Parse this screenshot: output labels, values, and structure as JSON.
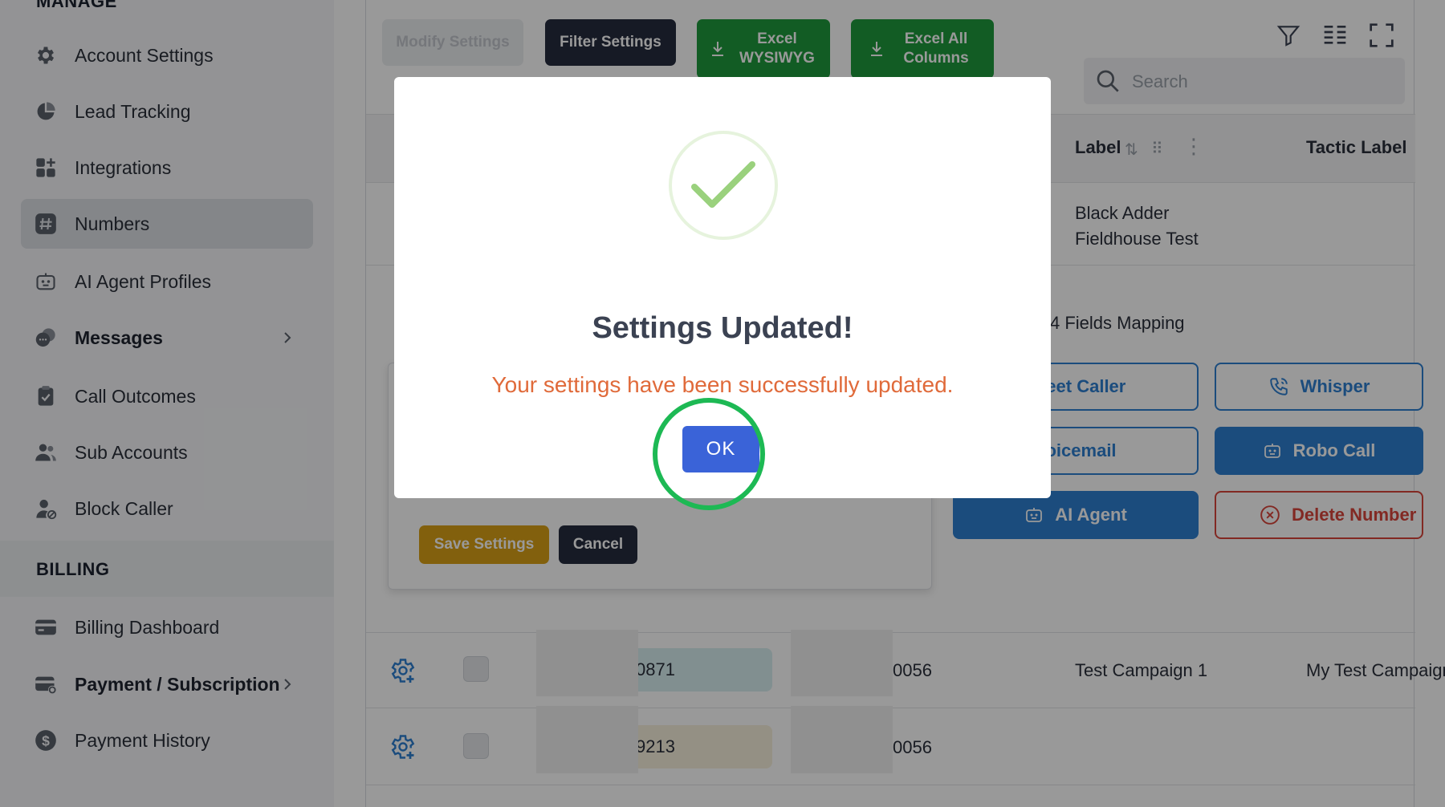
{
  "sidebar": {
    "manage_heading": "MANAGE",
    "billing_heading": "BILLING",
    "manage_items": [
      {
        "label": "Account Settings",
        "icon": "gear-icon"
      },
      {
        "label": "Lead Tracking",
        "icon": "pie-chart-icon"
      },
      {
        "label": "Integrations",
        "icon": "apps-grid-icon"
      },
      {
        "label": "Numbers",
        "icon": "hash-icon",
        "active": true
      },
      {
        "label": "AI Agent Profiles",
        "icon": "robot-icon"
      },
      {
        "label": "Messages",
        "icon": "chat-bubbles-icon",
        "has_submenu": true
      },
      {
        "label": "Call Outcomes",
        "icon": "clipboard-check-icon"
      },
      {
        "label": "Sub Accounts",
        "icon": "users-icon"
      },
      {
        "label": "Block Caller",
        "icon": "user-block-icon"
      }
    ],
    "billing_items": [
      {
        "label": "Billing Dashboard",
        "icon": "credit-card-icon"
      },
      {
        "label": "Payment / Subscription",
        "icon": "card-settings-icon",
        "has_submenu": true
      },
      {
        "label": "Payment History",
        "icon": "dollar-circle-icon"
      }
    ]
  },
  "toolbar": {
    "modify_settings": "Modify Settings",
    "filter_settings": "Filter Settings",
    "excel_wysiwyg": "Excel WYSIWYG",
    "excel_all_columns": "Excel All Columns",
    "search_placeholder": "Search"
  },
  "table": {
    "headers": {
      "label": "Label",
      "tactic_label": "Tactic Label"
    },
    "first_row_label": "Black Adder Fieldhouse Test",
    "fields_mapping": "4 Fields Mapping",
    "action_buttons": {
      "greet_caller": "Greet Caller",
      "whisper": "Whisper",
      "voicemail": "Voicemail",
      "robo_call": "Robo Call",
      "ai_agent": "AI Agent",
      "delete_number": "Delete Number"
    },
    "panel_buttons": {
      "save": "Save Settings",
      "cancel": "Cancel"
    },
    "rows": [
      {
        "number_tail": "0871",
        "forward_tail": "0056",
        "label": "Test Campaign 1",
        "tactic": "My Test Campaign"
      },
      {
        "number_tail": "9213",
        "forward_tail": "0056",
        "label": "",
        "tactic": ""
      }
    ]
  },
  "modal": {
    "title": "Settings Updated!",
    "message": "Your settings have been successfully updated.",
    "ok_label": "OK",
    "icon": "checkmark-icon"
  },
  "colors": {
    "accent_blue": "#2d7fd1",
    "ok_blue": "#3a63d8",
    "excel_green": "#1e9a3c",
    "dark_navy": "#262c3e",
    "save_gold": "#d9a017",
    "delete_red": "#d9453b",
    "message_orange": "#e06a3a",
    "highlight_green": "#1db954"
  }
}
